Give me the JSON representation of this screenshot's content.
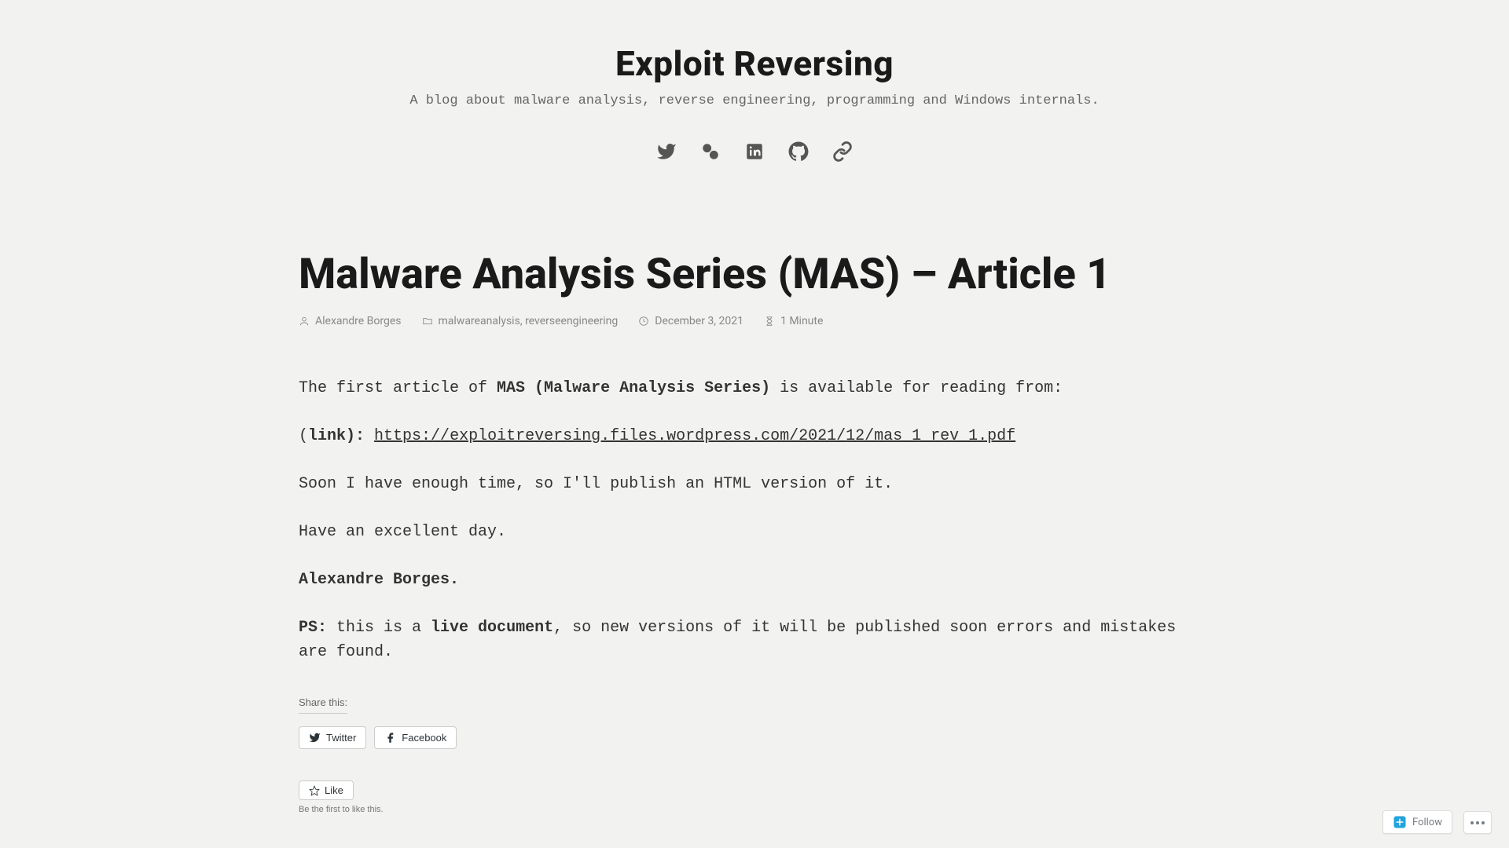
{
  "header": {
    "site_title": "Exploit Reversing",
    "tagline": "A blog about malware analysis, reverse engineering, programming and Windows internals."
  },
  "social": {
    "twitter": "twitter",
    "slides": "slides",
    "linkedin": "linkedin",
    "github": "github",
    "link": "link"
  },
  "article": {
    "title": "Malware Analysis Series (MAS) – Article 1"
  },
  "meta": {
    "author": "Alexandre Borges",
    "tag1": "malwareanalysis",
    "tag_sep": ", ",
    "tag2": "reverseengineering",
    "date": "December 3, 2021",
    "read_time": "1 Minute"
  },
  "body": {
    "p1_a": "The first article of ",
    "p1_b": "MAS (Malware Analysis Series)",
    "p1_c": " is available for reading from:",
    "p2_a": "(",
    "p2_b": "link):",
    "p2_c": " ",
    "p2_link": "https://exploitreversing.files.wordpress.com/2021/12/mas_1_rev_1.pdf",
    "p3": "Soon I have enough time, so I'll publish an HTML version of it.",
    "p4": "Have an excellent day.",
    "p5": "Alexandre Borges.",
    "p6_a": "PS:",
    "p6_b": " this is a ",
    "p6_c": "live document",
    "p6_d": ", so new versions of it will be published soon errors and mistakes are found."
  },
  "share": {
    "label": "Share this:",
    "twitter": "Twitter",
    "facebook": "Facebook"
  },
  "like": {
    "button": "Like",
    "caption": "Be the first to like this."
  },
  "follow": {
    "label": "Follow"
  }
}
